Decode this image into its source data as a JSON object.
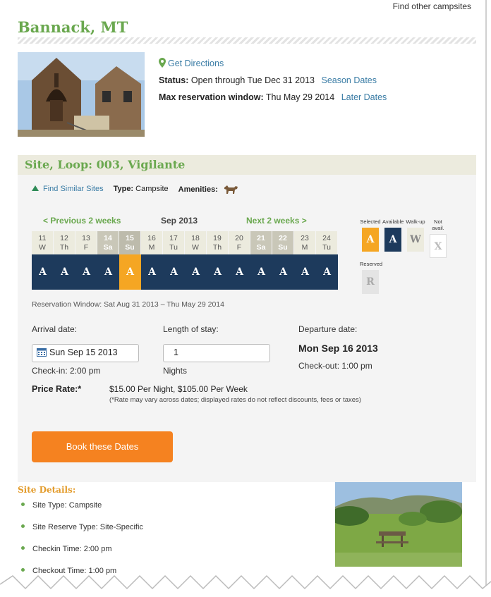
{
  "header": {
    "find_other": "Find other campsites",
    "park_name": "Bannack, MT"
  },
  "park_info": {
    "directions": "Get Directions",
    "status_label": "Status:",
    "status_value": "Open through Tue Dec 31 2013",
    "season_link": "Season Dates",
    "max_label": "Max reservation window:",
    "max_value": "Thu May 29 2014",
    "later_link": "Later Dates"
  },
  "site": {
    "title": "Site, Loop: 003, Vigilante",
    "find_similar": "Find Similar Sites",
    "type_label": "Type:",
    "type_value": "Campsite",
    "amenities_label": "Amenities:",
    "amenity_icon": "pet-friendly-icon"
  },
  "calendar": {
    "prev": "< Previous 2 weeks",
    "month": "Sep 2013",
    "next": "Next 2 weeks >",
    "days": [
      {
        "num": "11",
        "dow": "W"
      },
      {
        "num": "12",
        "dow": "Th"
      },
      {
        "num": "13",
        "dow": "F"
      },
      {
        "num": "14",
        "dow": "Sa"
      },
      {
        "num": "15",
        "dow": "Su"
      },
      {
        "num": "16",
        "dow": "M"
      },
      {
        "num": "17",
        "dow": "Tu"
      },
      {
        "num": "18",
        "dow": "W"
      },
      {
        "num": "19",
        "dow": "Th"
      },
      {
        "num": "20",
        "dow": "F"
      },
      {
        "num": "21",
        "dow": "Sa"
      },
      {
        "num": "22",
        "dow": "Su"
      },
      {
        "num": "23",
        "dow": "M"
      },
      {
        "num": "24",
        "dow": "Tu"
      }
    ],
    "availability": [
      "A",
      "A",
      "A",
      "A",
      "A",
      "A",
      "A",
      "A",
      "A",
      "A",
      "A",
      "A",
      "A",
      "A"
    ],
    "selected_index": 4,
    "reservation_window": "Reservation Window: Sat Aug 31 2013 – Thu May 29 2014"
  },
  "legend": {
    "selected": {
      "label": "Selected",
      "code": "A"
    },
    "available": {
      "label": "Available",
      "code": "A"
    },
    "walkup": {
      "label": "Walk-up",
      "code": "W"
    },
    "not_avail": {
      "label": "Not avail.",
      "code": "X"
    },
    "reserved": {
      "label": "Reserved",
      "code": "R"
    }
  },
  "booking": {
    "arrival_label": "Arrival date:",
    "arrival_value": "Sun Sep 15 2013",
    "checkin": "Check-in: 2:00 pm",
    "stay_label": "Length of stay:",
    "stay_value": "1",
    "nights": "Nights",
    "departure_label": "Departure date:",
    "departure_value": "Mon Sep 16 2013",
    "checkout": "Check-out: 1:00 pm",
    "price_label": "Price Rate:*",
    "price_value": "$15.00 Per Night, $105.00 Per Week",
    "price_note": "(*Rate may vary across dates; displayed rates do not reflect discounts, fees or taxes)",
    "book_button": "Book these Dates"
  },
  "details": {
    "title": "Site Details:",
    "items": [
      "Site Type: Campsite",
      "Site Reserve Type: Site-Specific",
      "Checkin Time: 2:00 pm",
      "Checkout Time: 1:00 pm"
    ]
  },
  "colors": {
    "brand_green": "#6aa84f",
    "navy": "#1d3a5c",
    "selected_orange": "#f5a623",
    "book_orange": "#f58220"
  }
}
